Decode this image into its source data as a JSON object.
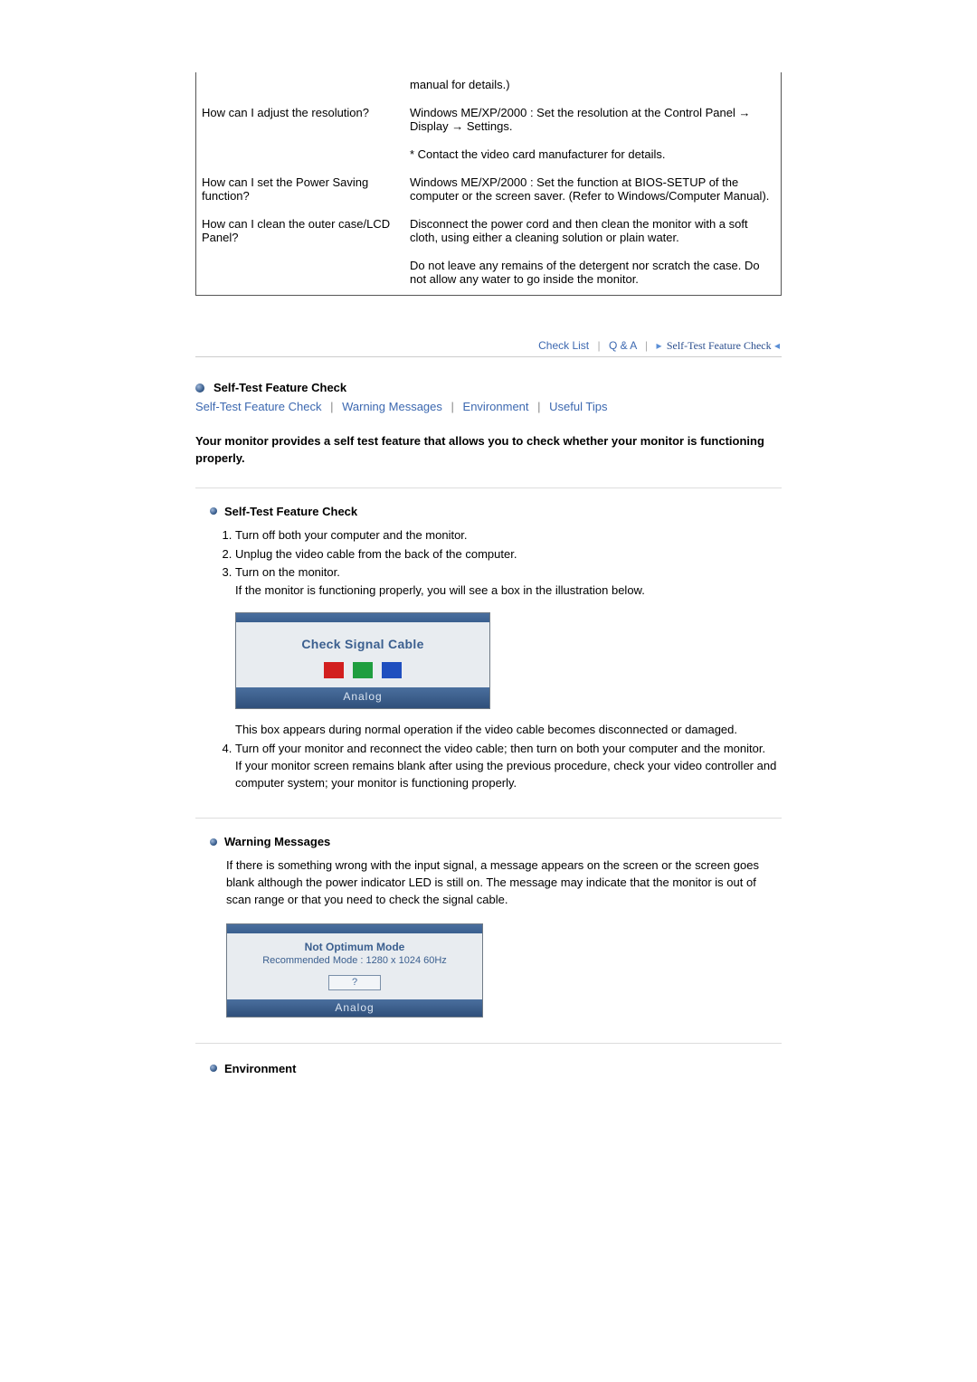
{
  "qa": [
    {
      "question": "",
      "answer": "manual for details.)"
    },
    {
      "question": "How can I adjust the resolution?",
      "answer": "Windows ME/XP/2000 : Set the resolution at the Control Panel → Display → Settings.",
      "extra": "* Contact the video card manufacturer for details."
    },
    {
      "question": "How can I set the Power Saving function?",
      "answer": "Windows ME/XP/2000 : Set the function at BIOS-SETUP of the computer or the screen saver. (Refer to Windows/Computer Manual)."
    },
    {
      "question": "How can I clean the outer case/LCD Panel?",
      "answer": "Disconnect the power cord and then clean the monitor with a soft cloth, using either a cleaning solution or plain water.",
      "extra": "Do not leave any remains of the detergent nor scratch the case. Do not allow any water to go inside the monitor."
    }
  ],
  "nav": {
    "check_list": "Check List",
    "qa": "Q & A",
    "self_test": "Self-Test Feature Check"
  },
  "section_title": "Self-Test Feature Check",
  "sublinks": {
    "self_test": "Self-Test Feature Check",
    "warning": "Warning Messages",
    "environment": "Environment",
    "tips": "Useful Tips"
  },
  "intro": "Your monitor provides a self test feature that allows you to check whether your monitor is functioning properly.",
  "selftest": {
    "title": "Self-Test Feature Check",
    "steps": {
      "s1": "Turn off both your computer and the monitor.",
      "s2": "Unplug the video cable from the back of the computer.",
      "s3": "Turn on the monitor.",
      "s3_sub": "If the monitor is functioning properly, you will see a box in the illustration below.",
      "s4": "Turn off your monitor and reconnect the video cable; then turn on both your computer and the monitor.",
      "s4_sub": "If your monitor screen remains blank after using the previous procedure, check your video controller and computer system; your monitor is functioning properly."
    },
    "osd_msg": "Check Signal Cable",
    "osd_mode": "Analog",
    "after_box": "This box appears during normal operation if the video cable becomes disconnected or damaged."
  },
  "warning": {
    "title": "Warning Messages",
    "body": "If there is something wrong with the input signal, a message appears on the screen or the screen goes blank although the power indicator LED is still on. The message may indicate that the monitor is out of scan range or that you need to check the signal cable.",
    "osd_line1": "Not Optimum Mode",
    "osd_line2": "Recommended Mode : 1280 x 1024   60Hz",
    "osd_btn": "?",
    "osd_mode": "Analog"
  },
  "environment": {
    "title": "Environment"
  }
}
